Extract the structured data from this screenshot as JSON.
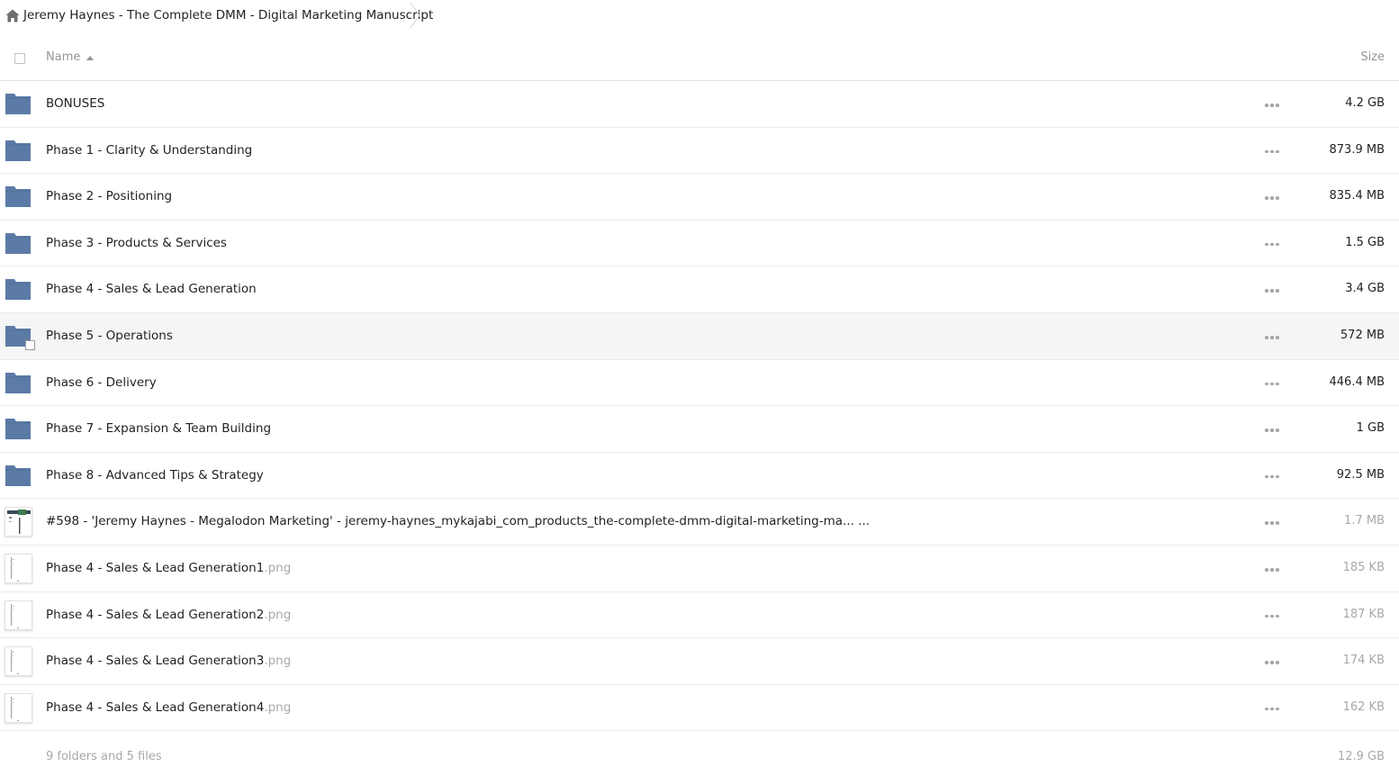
{
  "breadcrumb": {
    "home_icon": "home-icon",
    "title": "Jeremy Haynes - The Complete DMM - Digital Marketing Manuscript"
  },
  "header": {
    "name_label": "Name",
    "size_label": "Size",
    "sort_icon": "sort-ascending-icon"
  },
  "rows": [
    {
      "type": "folder",
      "name": "BONUSES",
      "ext": "",
      "size": "4.2 GB"
    },
    {
      "type": "folder",
      "name": "Phase 1 - Clarity & Understanding",
      "ext": "",
      "size": "873.9 MB"
    },
    {
      "type": "folder",
      "name": "Phase 2 - Positioning",
      "ext": "",
      "size": "835.4 MB"
    },
    {
      "type": "folder",
      "name": "Phase 3 - Products & Services",
      "ext": "",
      "size": "1.5 GB"
    },
    {
      "type": "folder",
      "name": "Phase 4 - Sales & Lead Generation",
      "ext": "",
      "size": "3.4 GB"
    },
    {
      "type": "folder",
      "name": "Phase 5 - Operations",
      "ext": "",
      "size": "572 MB",
      "hover": true
    },
    {
      "type": "folder",
      "name": "Phase 6 - Delivery",
      "ext": "",
      "size": "446.4 MB"
    },
    {
      "type": "folder",
      "name": "Phase 7 - Expansion & Team Building",
      "ext": "",
      "size": "1 GB"
    },
    {
      "type": "folder",
      "name": "Phase 8 - Advanced Tips & Strategy",
      "ext": "",
      "size": "92.5 MB"
    },
    {
      "type": "file",
      "name": "#598 - 'Jeremy Haynes - Megalodon Marketing' - jeremy-haynes_mykajabi_com_products_the-complete-dmm-digital-marketing-ma...  ...",
      "ext": "",
      "size": "1.7 MB",
      "thumb": "screenshot"
    },
    {
      "type": "file",
      "name": "Phase 4 - Sales & Lead Generation1",
      "ext": ".png",
      "size": "185 KB",
      "thumb": "page"
    },
    {
      "type": "file",
      "name": "Phase 4 - Sales & Lead Generation2",
      "ext": ".png",
      "size": "187 KB",
      "thumb": "page"
    },
    {
      "type": "file",
      "name": "Phase 4 - Sales & Lead Generation3",
      "ext": ".png",
      "size": "174 KB",
      "thumb": "page"
    },
    {
      "type": "file",
      "name": "Phase 4 - Sales & Lead Generation4",
      "ext": ".png",
      "size": "162 KB",
      "thumb": "page"
    }
  ],
  "footer": {
    "summary": "9 folders and 5 files",
    "total": "12.9 GB"
  },
  "colors": {
    "folder": "#5b7ba6",
    "muted_text": "#a8a8a8",
    "divider": "#ebebeb"
  }
}
